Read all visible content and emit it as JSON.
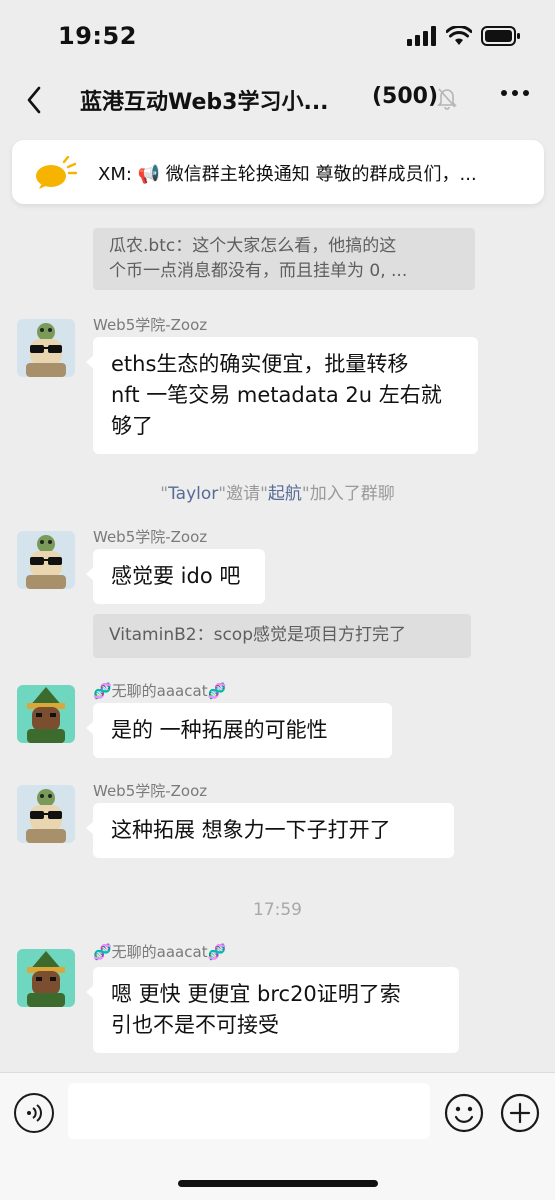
{
  "status_bar": {
    "time": "19:52"
  },
  "nav": {
    "title": "蓝港互动Web3学习小...",
    "member_count": "(500)",
    "back_icon": "chevron-left-icon",
    "mute_icon": "bell-slash-icon",
    "more_icon": "ellipsis-icon"
  },
  "announcement": {
    "text": "XM: 📢 微信群主轮换通知 尊敬的群成员们，..."
  },
  "messages": {
    "quote1_line1": "瓜农.btc：这个大家怎么看，他搞的这",
    "quote1_line2": "个币一点消息都没有，而且挂单为 0, ...",
    "msg1_sender": "Web5学院-Zooz",
    "msg1_line1": "eths生态的确实便宜，批量转移",
    "msg1_line2": "nft 一笔交易 metadata 2u 左右就",
    "msg1_line3": "够了",
    "sys_q1": "\"",
    "sys_name1": "Taylor",
    "sys_mid": "\"邀请\"",
    "sys_name2": "起航",
    "sys_end": "\"加入了群聊",
    "msg2_sender": "Web5学院-Zooz",
    "msg2_text": "感觉要 ido 吧",
    "quote2": "VitaminB2：scop感觉是项目方打完了",
    "msg3_sender": "🧬无聊的aaacat🧬",
    "msg3_text": "是的  一种拓展的可能性",
    "msg4_sender": "Web5学院-Zooz",
    "msg4_text": "这种拓展 想象力一下子打开了",
    "timestamp": "17:59",
    "msg5_sender": "🧬无聊的aaacat🧬",
    "msg5_line1": "嗯 更快 更便宜 brc20证明了索",
    "msg5_line2": "引也不是不可接受"
  },
  "bottom": {
    "input_placeholder": ""
  },
  "colors": {
    "background": "#ededed",
    "bubble": "#ffffff",
    "link": "#576b95",
    "quote_bg": "#dedede"
  }
}
